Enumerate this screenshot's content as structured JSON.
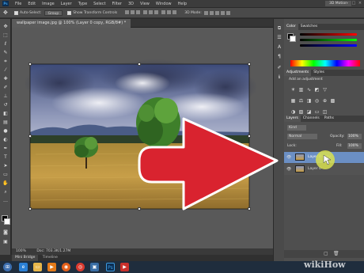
{
  "menu": {
    "logo": "Ps",
    "items": [
      "File",
      "Edit",
      "Image",
      "Layer",
      "Type",
      "Select",
      "Filter",
      "3D",
      "View",
      "Window",
      "Help"
    ],
    "workspace": "3D Motion",
    "win_min": "–",
    "win_max": "□",
    "win_close": "×"
  },
  "options": {
    "auto_select": "Auto-Select:",
    "group": "Group",
    "transform": "Show Transform Controls",
    "mode_3d": "3D Mode:"
  },
  "document": {
    "tab_label": "wallpaper image.jpg @ 100% (Layer 0 copy, RGB/8#) *",
    "zoom": "100%",
    "doc_size": "Doc: 703.3K/1.27M"
  },
  "bottom_tabs": [
    "Mini Bridge",
    "Timeline"
  ],
  "panels": {
    "color_tabs": [
      "Color",
      "Swatches"
    ],
    "adjust_tabs": [
      "Adjustments",
      "Styles"
    ],
    "adjust_title": "Add an adjustment",
    "layers_tabs": [
      "Layers",
      "Channels",
      "Paths"
    ],
    "kind": "Kind",
    "blend_mode": "Normal",
    "opacity_label": "Opacity:",
    "opacity_value": "100%",
    "lock_label": "Lock:",
    "fill_label": "Fill:",
    "fill_value": "100%",
    "layers": [
      "Layer 0 copy",
      "Layer 0"
    ]
  },
  "taskbar": {
    "items": [
      "ie-icon",
      "folder-icon",
      "media-icon",
      "firefox-icon",
      "chrome-icon",
      "photoshop-icon",
      "app-icon"
    ],
    "ps_label": "Ps"
  },
  "watermark": {
    "a": "wiki",
    "b": "How"
  },
  "colors": {
    "arrow_red": "#d9232f",
    "arrow_outline": "#ffffff",
    "cursor_yellow": "#d8e050",
    "sky": "#5b6ea0",
    "field": "#b8923f"
  }
}
